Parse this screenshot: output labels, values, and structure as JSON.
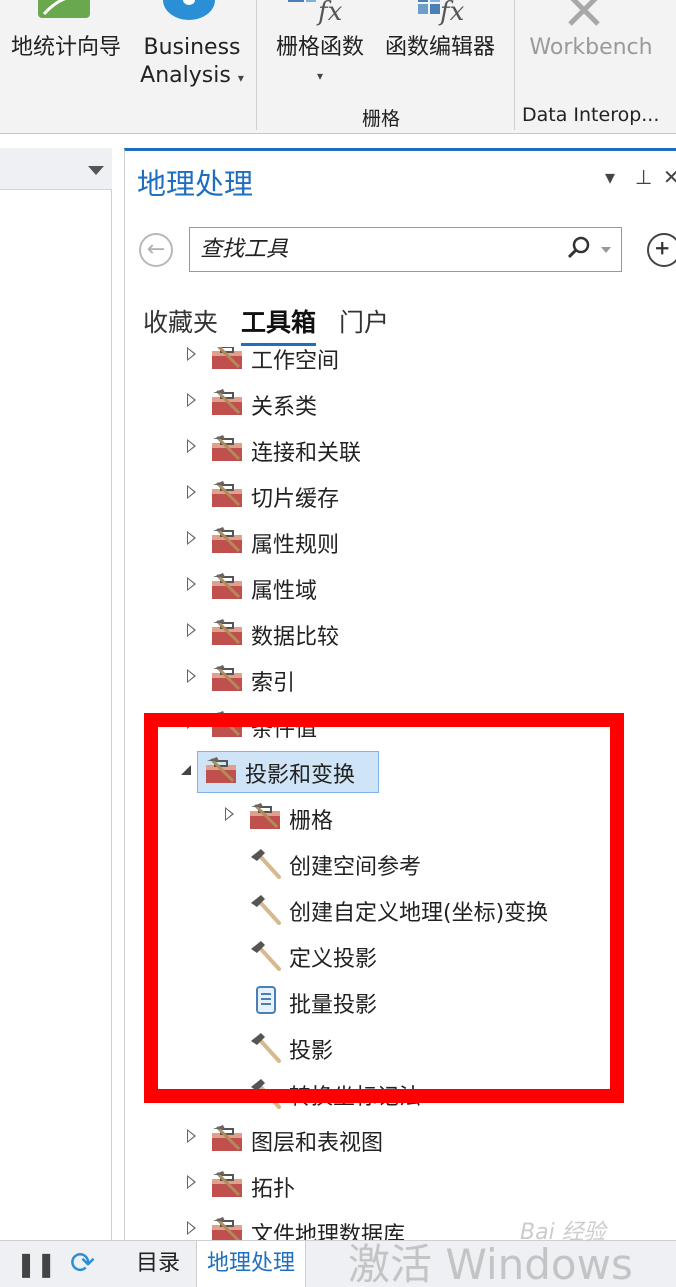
{
  "ribbon": {
    "geostat_wizard_label": "地统计向导",
    "business_analysis_line1": "Business",
    "business_analysis_line2": "Analysis",
    "raster_functions_label": "栅格函数",
    "function_editor_label": "函数编辑器",
    "workbench_label": "Workbench",
    "raster_group_label": "栅格",
    "data_interop_group_label": "Data Interop...",
    "fx_glyph": "fx",
    "caret": "▾"
  },
  "gp_pane": {
    "title": "地理处理",
    "pin_glyph": "⊥",
    "close_glyph": "✕",
    "menu_glyph": "▾",
    "search_placeholder": "查找工具",
    "tabs": [
      "收藏夹",
      "工具箱",
      "门户"
    ],
    "active_tab": "工具箱"
  },
  "tree": {
    "toolboxes_before": [
      "工作空间",
      "关系类",
      "连接和关联",
      "切片缓存",
      "属性规则",
      "属性域",
      "数据比较",
      "索引",
      "条件值"
    ],
    "expanded_toolbox": "投影和变换",
    "children": [
      {
        "label": "栅格",
        "icon": "toolbox-icon",
        "has_expander": true
      },
      {
        "label": "创建空间参考",
        "icon": "hammer-tool-icon",
        "has_expander": false
      },
      {
        "label": "创建自定义地理(坐标)变换",
        "icon": "hammer-tool-icon",
        "has_expander": false
      },
      {
        "label": "定义投影",
        "icon": "hammer-tool-icon",
        "has_expander": false
      },
      {
        "label": "批量投影",
        "icon": "script-tool-icon",
        "has_expander": false
      },
      {
        "label": "投影",
        "icon": "hammer-tool-icon",
        "has_expander": false
      },
      {
        "label": "转换坐标记法",
        "icon": "hammer-tool-icon",
        "has_expander": false
      }
    ],
    "toolboxes_after": [
      "图层和表视图",
      "拓扑",
      "文件地理数据库"
    ]
  },
  "bottom_bar": {
    "tabs": [
      "目录",
      "地理处理"
    ],
    "active_tab": "地理处理",
    "pause_glyph": "❚❚",
    "refresh_glyph": "⟳"
  },
  "watermark": {
    "activate_windows": "激活 Windows",
    "baidu_experience": "Bai 经验"
  },
  "colors": {
    "accent_blue": "#1f6fc0",
    "highlight_red": "#ff0000",
    "selection_bg": "#cfe4f7",
    "toolbox_red": "#c0504d"
  }
}
